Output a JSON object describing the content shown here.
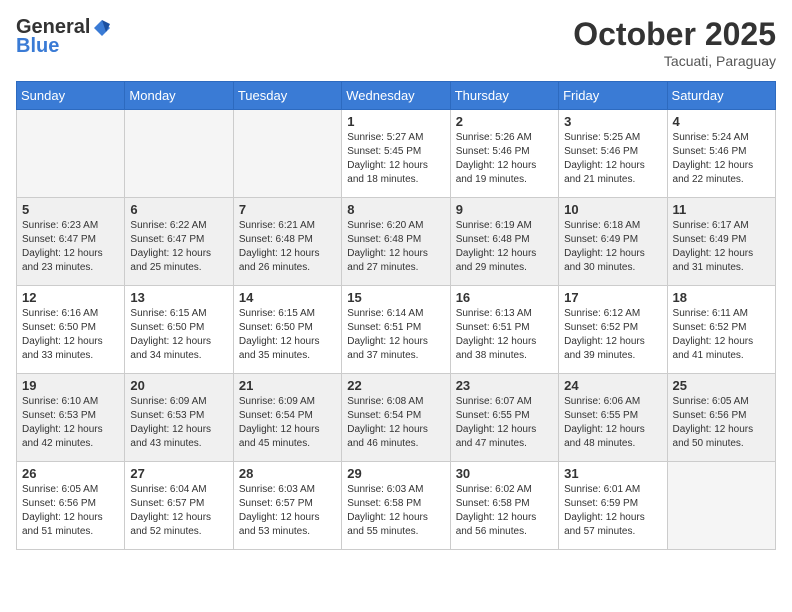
{
  "header": {
    "logo": {
      "general": "General",
      "blue": "Blue"
    },
    "title": "October 2025",
    "subtitle": "Tacuati, Paraguay"
  },
  "weekdays": [
    "Sunday",
    "Monday",
    "Tuesday",
    "Wednesday",
    "Thursday",
    "Friday",
    "Saturday"
  ],
  "weeks": [
    [
      {
        "day": "",
        "info": ""
      },
      {
        "day": "",
        "info": ""
      },
      {
        "day": "",
        "info": ""
      },
      {
        "day": "1",
        "info": "Sunrise: 5:27 AM\nSunset: 5:45 PM\nDaylight: 12 hours and 18 minutes."
      },
      {
        "day": "2",
        "info": "Sunrise: 5:26 AM\nSunset: 5:46 PM\nDaylight: 12 hours and 19 minutes."
      },
      {
        "day": "3",
        "info": "Sunrise: 5:25 AM\nSunset: 5:46 PM\nDaylight: 12 hours and 21 minutes."
      },
      {
        "day": "4",
        "info": "Sunrise: 5:24 AM\nSunset: 5:46 PM\nDaylight: 12 hours and 22 minutes."
      }
    ],
    [
      {
        "day": "5",
        "info": "Sunrise: 6:23 AM\nSunset: 6:47 PM\nDaylight: 12 hours and 23 minutes."
      },
      {
        "day": "6",
        "info": "Sunrise: 6:22 AM\nSunset: 6:47 PM\nDaylight: 12 hours and 25 minutes."
      },
      {
        "day": "7",
        "info": "Sunrise: 6:21 AM\nSunset: 6:48 PM\nDaylight: 12 hours and 26 minutes."
      },
      {
        "day": "8",
        "info": "Sunrise: 6:20 AM\nSunset: 6:48 PM\nDaylight: 12 hours and 27 minutes."
      },
      {
        "day": "9",
        "info": "Sunrise: 6:19 AM\nSunset: 6:48 PM\nDaylight: 12 hours and 29 minutes."
      },
      {
        "day": "10",
        "info": "Sunrise: 6:18 AM\nSunset: 6:49 PM\nDaylight: 12 hours and 30 minutes."
      },
      {
        "day": "11",
        "info": "Sunrise: 6:17 AM\nSunset: 6:49 PM\nDaylight: 12 hours and 31 minutes."
      }
    ],
    [
      {
        "day": "12",
        "info": "Sunrise: 6:16 AM\nSunset: 6:50 PM\nDaylight: 12 hours and 33 minutes."
      },
      {
        "day": "13",
        "info": "Sunrise: 6:15 AM\nSunset: 6:50 PM\nDaylight: 12 hours and 34 minutes."
      },
      {
        "day": "14",
        "info": "Sunrise: 6:15 AM\nSunset: 6:50 PM\nDaylight: 12 hours and 35 minutes."
      },
      {
        "day": "15",
        "info": "Sunrise: 6:14 AM\nSunset: 6:51 PM\nDaylight: 12 hours and 37 minutes."
      },
      {
        "day": "16",
        "info": "Sunrise: 6:13 AM\nSunset: 6:51 PM\nDaylight: 12 hours and 38 minutes."
      },
      {
        "day": "17",
        "info": "Sunrise: 6:12 AM\nSunset: 6:52 PM\nDaylight: 12 hours and 39 minutes."
      },
      {
        "day": "18",
        "info": "Sunrise: 6:11 AM\nSunset: 6:52 PM\nDaylight: 12 hours and 41 minutes."
      }
    ],
    [
      {
        "day": "19",
        "info": "Sunrise: 6:10 AM\nSunset: 6:53 PM\nDaylight: 12 hours and 42 minutes."
      },
      {
        "day": "20",
        "info": "Sunrise: 6:09 AM\nSunset: 6:53 PM\nDaylight: 12 hours and 43 minutes."
      },
      {
        "day": "21",
        "info": "Sunrise: 6:09 AM\nSunset: 6:54 PM\nDaylight: 12 hours and 45 minutes."
      },
      {
        "day": "22",
        "info": "Sunrise: 6:08 AM\nSunset: 6:54 PM\nDaylight: 12 hours and 46 minutes."
      },
      {
        "day": "23",
        "info": "Sunrise: 6:07 AM\nSunset: 6:55 PM\nDaylight: 12 hours and 47 minutes."
      },
      {
        "day": "24",
        "info": "Sunrise: 6:06 AM\nSunset: 6:55 PM\nDaylight: 12 hours and 48 minutes."
      },
      {
        "day": "25",
        "info": "Sunrise: 6:05 AM\nSunset: 6:56 PM\nDaylight: 12 hours and 50 minutes."
      }
    ],
    [
      {
        "day": "26",
        "info": "Sunrise: 6:05 AM\nSunset: 6:56 PM\nDaylight: 12 hours and 51 minutes."
      },
      {
        "day": "27",
        "info": "Sunrise: 6:04 AM\nSunset: 6:57 PM\nDaylight: 12 hours and 52 minutes."
      },
      {
        "day": "28",
        "info": "Sunrise: 6:03 AM\nSunset: 6:57 PM\nDaylight: 12 hours and 53 minutes."
      },
      {
        "day": "29",
        "info": "Sunrise: 6:03 AM\nSunset: 6:58 PM\nDaylight: 12 hours and 55 minutes."
      },
      {
        "day": "30",
        "info": "Sunrise: 6:02 AM\nSunset: 6:58 PM\nDaylight: 12 hours and 56 minutes."
      },
      {
        "day": "31",
        "info": "Sunrise: 6:01 AM\nSunset: 6:59 PM\nDaylight: 12 hours and 57 minutes."
      },
      {
        "day": "",
        "info": ""
      }
    ]
  ]
}
